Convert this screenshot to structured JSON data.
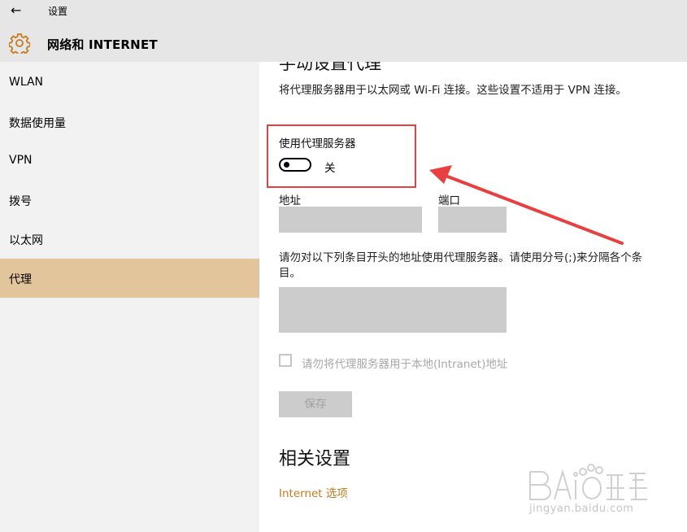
{
  "window": {
    "title": "设置",
    "back_glyph": "←"
  },
  "header": {
    "section_title": "网络和 INTERNET",
    "icon": "gear-icon"
  },
  "sidebar": {
    "items": [
      {
        "label": "WLAN",
        "active": false
      },
      {
        "label": "数据使用量",
        "active": false
      },
      {
        "label": "VPN",
        "active": false
      },
      {
        "label": "拨号",
        "active": false
      },
      {
        "label": "以太网",
        "active": false
      },
      {
        "label": "代理",
        "active": true
      }
    ]
  },
  "main": {
    "heading_cut": "手动设置代理",
    "description": "将代理服务器用于以太网或 Wi-Fi 连接。这些设置不适用于 VPN 连接。",
    "use_proxy_label": "使用代理服务器",
    "toggle_state": "关",
    "address_label": "地址",
    "port_label": "端口",
    "address_value": "",
    "port_value": "",
    "exceptions_help": "请勿对以下列条目开头的地址使用代理服务器。请使用分号(;)来分隔各个条目。",
    "exceptions_value": "",
    "bypass_local_label": "请勿将代理服务器用于本地(Intranet)地址",
    "save_label": "保存",
    "related_title": "相关设置",
    "internet_options_link": "Internet 选项"
  },
  "watermark": {
    "logo_text": "Baidu经验",
    "url_text": "jingyan.baidu.com"
  },
  "colors": {
    "accent": "#c57a1d",
    "active_nav": "#e3c59b",
    "annotation": "#e84040",
    "disabled_fill": "#cccccc"
  }
}
